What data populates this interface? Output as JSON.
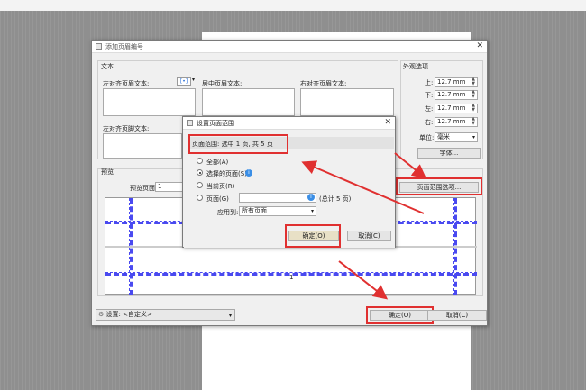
{
  "main_dialog": {
    "title": "添加页眉编号",
    "text_group": "文本",
    "header_left": "左对齐页眉文本:",
    "header_center": "居中页眉文本:",
    "header_right": "右对齐页眉文本:",
    "footer_left": "左对齐页脚文本:",
    "format_icon": "[•]",
    "appearance_group": "外观选项",
    "margins": [
      {
        "label": "上:",
        "value": "12.7 mm"
      },
      {
        "label": "下:",
        "value": "12.7 mm"
      },
      {
        "label": "左:",
        "value": "12.7 mm"
      },
      {
        "label": "右:",
        "value": "12.7 mm"
      }
    ],
    "unit_label": "单位:",
    "unit_value": "毫米",
    "font_button": "字体...",
    "page_range_button": "页面范围选项...",
    "preview_group": "预览",
    "preview_page_label": "预览页面",
    "preview_page_value": "1",
    "preview_page_number": "1",
    "settings_label": "设置:",
    "settings_value": "<自定义>",
    "ok_button": "确定(O)",
    "cancel_button": "取消(C)"
  },
  "range_dialog": {
    "title": "设置页面范围",
    "info": "页面范围: 选中 1 页, 共 5 页",
    "options": [
      {
        "label": "全部(A)",
        "selected": false
      },
      {
        "label": "选择的页面(S)",
        "selected": true
      },
      {
        "label": "当前页(R)",
        "selected": false
      },
      {
        "label": "页面(G)",
        "selected": false
      }
    ],
    "total_note": "(总计 5 页)",
    "apply_label": "应用到:",
    "apply_value": "所有页面",
    "ok_button": "确定(O)",
    "cancel_button": "取消(C)"
  },
  "colors": {
    "highlight": "#e03030",
    "dash": "#4a4af0"
  }
}
